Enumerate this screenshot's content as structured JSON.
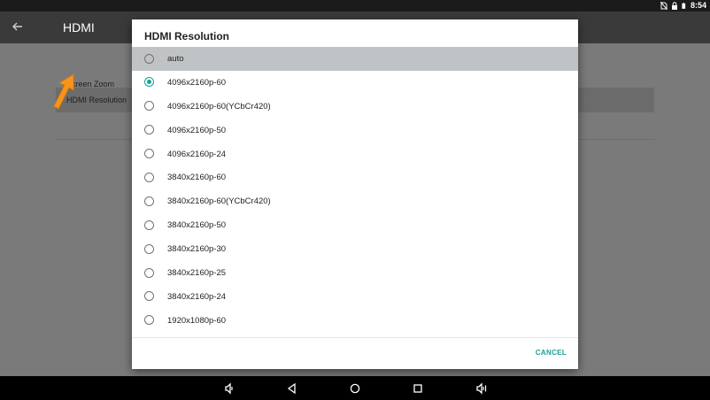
{
  "status_bar": {
    "time": "8:54",
    "icons": [
      "no-sim-icon",
      "lock-icon",
      "battery-icon"
    ]
  },
  "app_bar": {
    "title": "HDMI",
    "back_icon": "arrow-back-icon"
  },
  "settings_list": {
    "items": [
      {
        "label": "HDMI Resolution"
      },
      {
        "label": "Screen Zoom"
      }
    ]
  },
  "annotation": {
    "arrow_color": "#f7941d",
    "icon": "pointer-arrow-icon"
  },
  "dialog": {
    "title": "HDMI Resolution",
    "selected_value": "4096x2160p-60",
    "highlighted_value": "auto",
    "accent_color": "#15a497",
    "options": [
      {
        "label": "auto",
        "checked": false
      },
      {
        "label": "4096x2160p-60",
        "checked": true
      },
      {
        "label": "4096x2160p-60(YCbCr420)",
        "checked": false
      },
      {
        "label": "4096x2160p-50",
        "checked": false
      },
      {
        "label": "4096x2160p-24",
        "checked": false
      },
      {
        "label": "3840x2160p-60",
        "checked": false
      },
      {
        "label": "3840x2160p-60(YCbCr420)",
        "checked": false
      },
      {
        "label": "3840x2160p-50",
        "checked": false
      },
      {
        "label": "3840x2160p-30",
        "checked": false
      },
      {
        "label": "3840x2160p-25",
        "checked": false
      },
      {
        "label": "3840x2160p-24",
        "checked": false
      },
      {
        "label": "1920x1080p-60",
        "checked": false
      },
      {
        "label": "",
        "checked": false
      }
    ],
    "cancel_label": "CANCEL"
  },
  "nav_bar": {
    "buttons": [
      "volume-down-icon",
      "back-icon",
      "home-icon",
      "recents-icon",
      "volume-up-icon"
    ]
  }
}
